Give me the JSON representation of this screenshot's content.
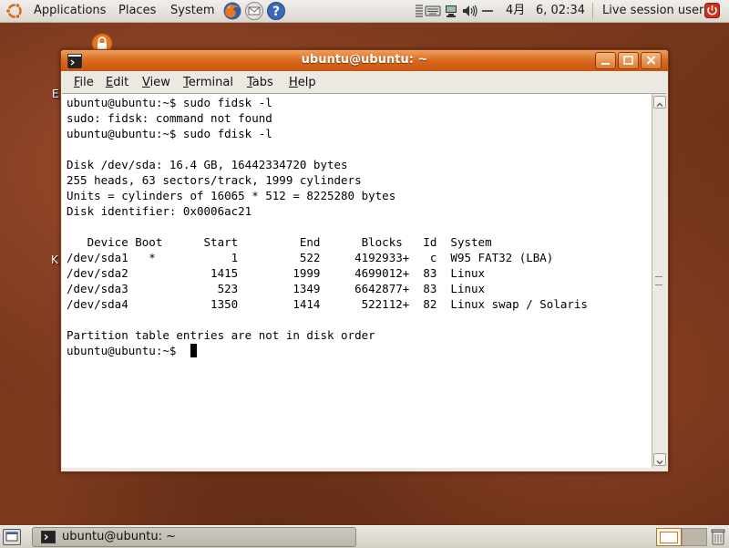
{
  "top_panel": {
    "menus": [
      "Applications",
      "Places",
      "System"
    ],
    "launchers": [
      "firefox-icon",
      "mail-icon",
      "help-icon"
    ],
    "tray_icons": [
      "notes-icon",
      "keyboard-icon",
      "network-icon",
      "volume-icon",
      "input-method-icon"
    ],
    "clock": {
      "month": "4月",
      "datetime": "6, 02:34"
    },
    "user": "Live session user"
  },
  "desktop": {
    "icon_fragments": [
      "E",
      "K"
    ]
  },
  "window": {
    "title": "ubuntu@ubuntu: ~",
    "menu": [
      {
        "label": "File",
        "mnemonic": "F"
      },
      {
        "label": "Edit",
        "mnemonic": "E"
      },
      {
        "label": "View",
        "mnemonic": "V"
      },
      {
        "label": "Terminal",
        "mnemonic": "T"
      },
      {
        "label": "Tabs",
        "mnemonic": "T"
      },
      {
        "label": "Help",
        "mnemonic": "H"
      }
    ],
    "terminal_lines": [
      "ubuntu@ubuntu:~$ sudo fidsk -l",
      "sudo: fidsk: command not found",
      "ubuntu@ubuntu:~$ sudo fdisk -l",
      "",
      "Disk /dev/sda: 16.4 GB, 16442334720 bytes",
      "255 heads, 63 sectors/track, 1999 cylinders",
      "Units = cylinders of 16065 * 512 = 8225280 bytes",
      "Disk identifier: 0x0006ac21",
      "",
      "   Device Boot      Start         End      Blocks   Id  System",
      "/dev/sda1   *           1         522     4192933+   c  W95 FAT32 (LBA)",
      "/dev/sda2            1415        1999     4699012+  83  Linux",
      "/dev/sda3             523        1349     6642877+  83  Linux",
      "/dev/sda4            1350        1414      522112+  82  Linux swap / Solaris",
      "",
      "Partition table entries are not in disk order",
      "ubuntu@ubuntu:~$ "
    ]
  },
  "bottom_panel": {
    "task": "ubuntu@ubuntu: ~"
  }
}
